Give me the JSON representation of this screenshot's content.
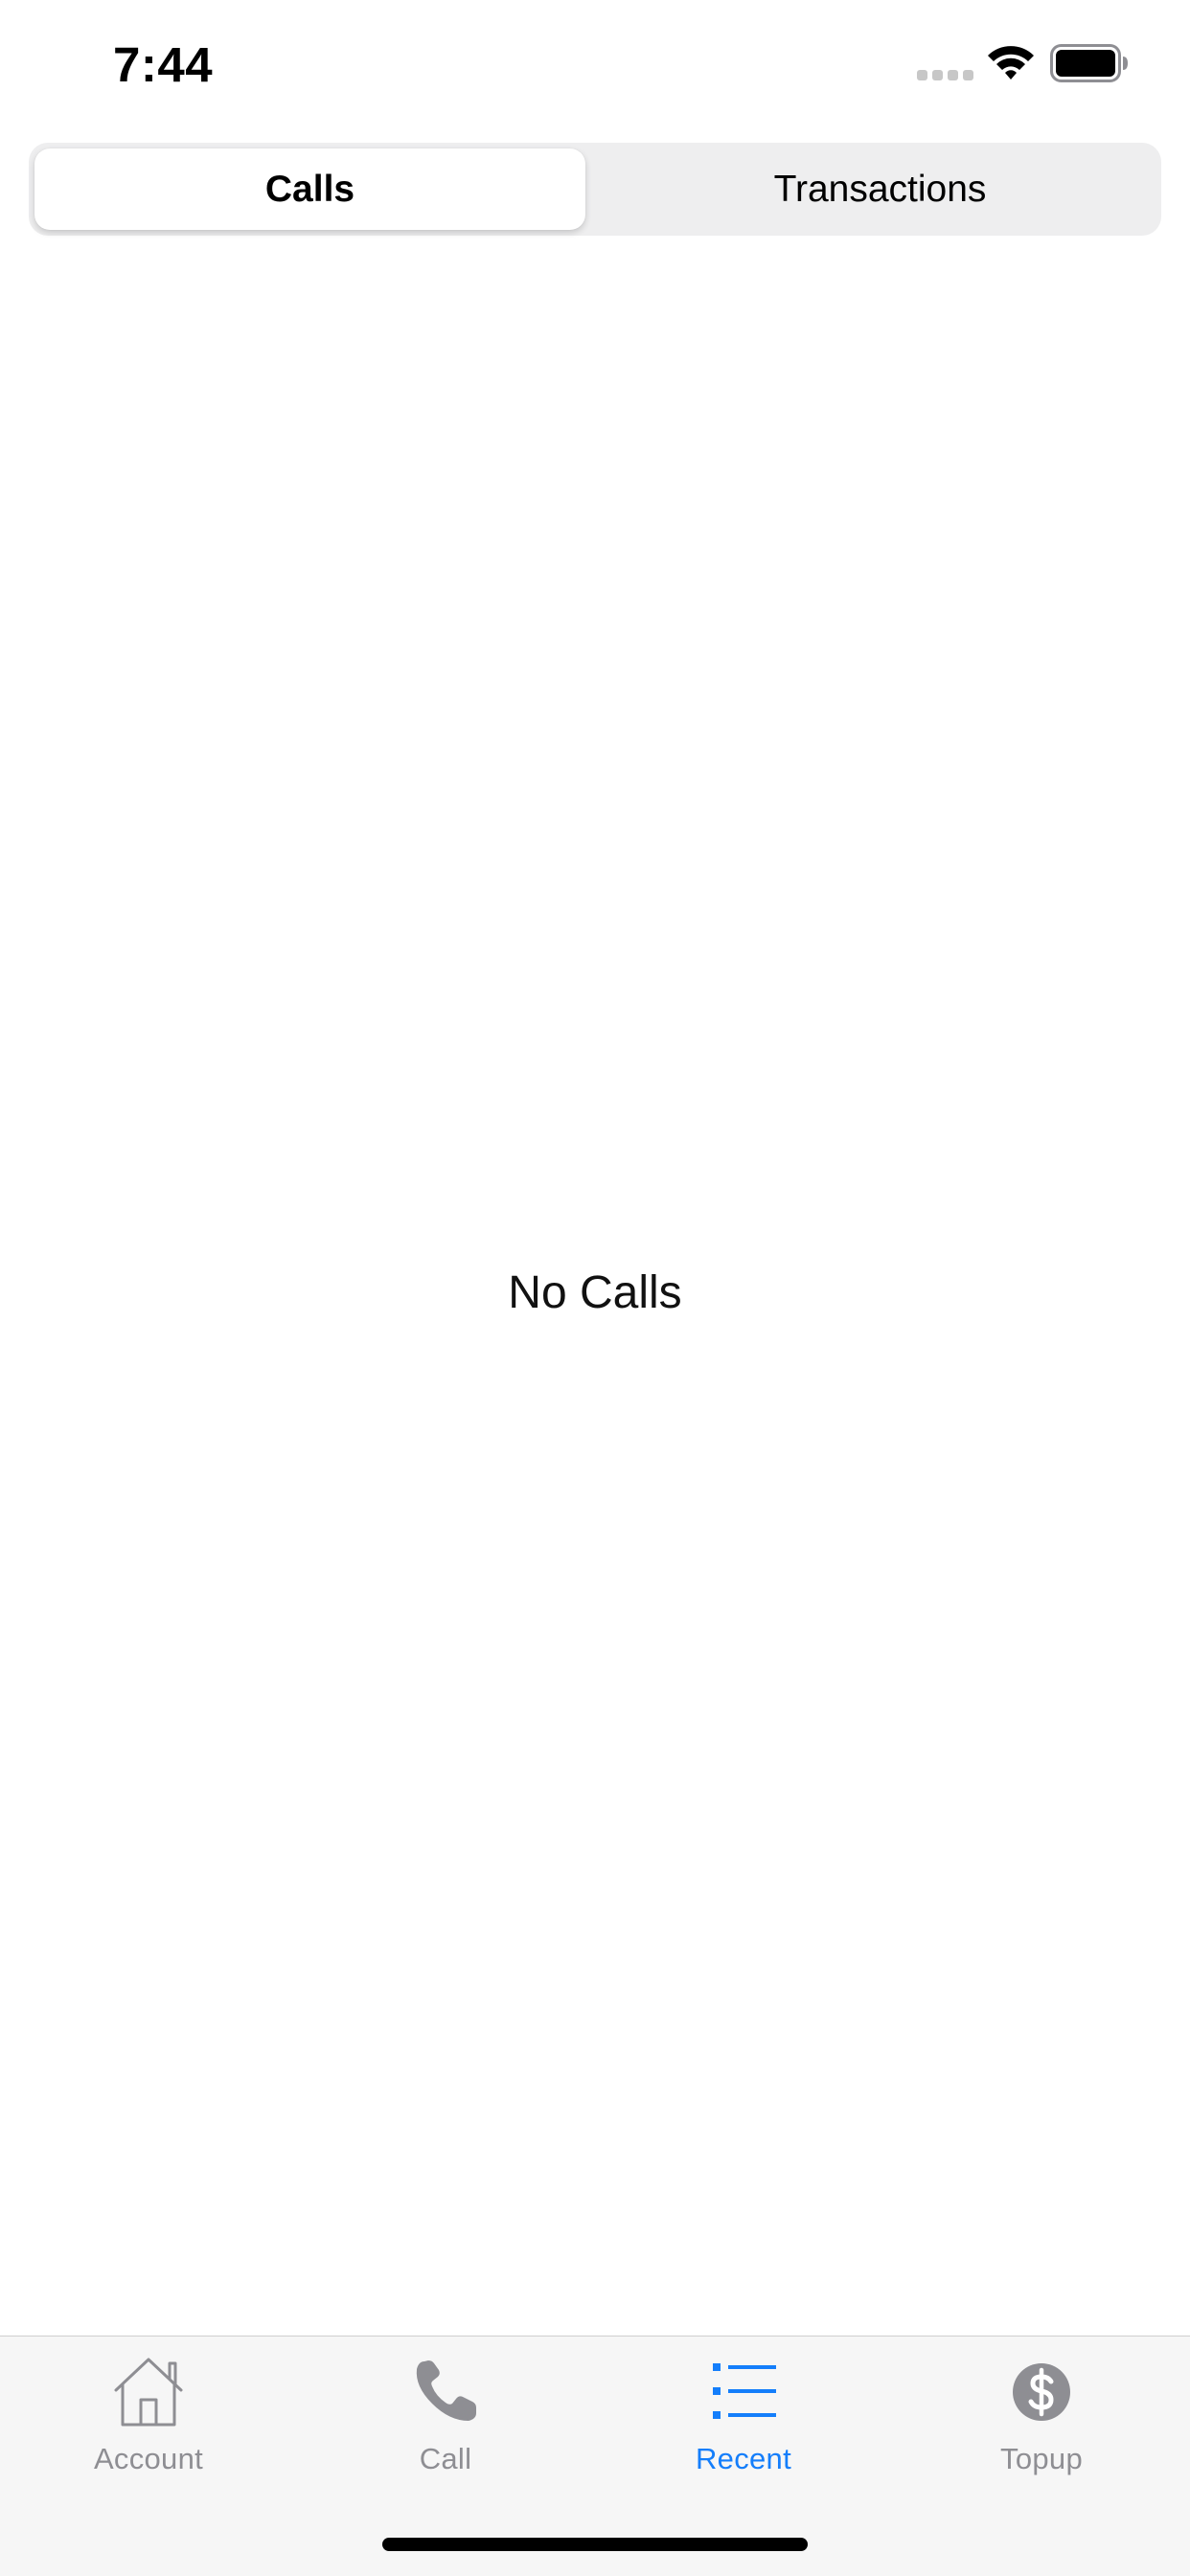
{
  "status_bar": {
    "time": "7:44",
    "icons": [
      "signal-dots-icon",
      "wifi-icon",
      "battery-icon"
    ]
  },
  "segmented_control": {
    "segments": [
      {
        "label": "Calls",
        "selected": true
      },
      {
        "label": "Transactions",
        "selected": false
      }
    ]
  },
  "empty_state": {
    "message": "No Calls"
  },
  "tab_bar": {
    "active_color": "#147efb",
    "inactive_color": "#8e8e93",
    "tabs": [
      {
        "label": "Account",
        "icon": "house-icon",
        "active": false
      },
      {
        "label": "Call",
        "icon": "phone-icon",
        "active": false
      },
      {
        "label": "Recent",
        "icon": "list-icon",
        "active": true
      },
      {
        "label": "Topup",
        "icon": "dollar-circle-icon",
        "active": false
      }
    ]
  }
}
